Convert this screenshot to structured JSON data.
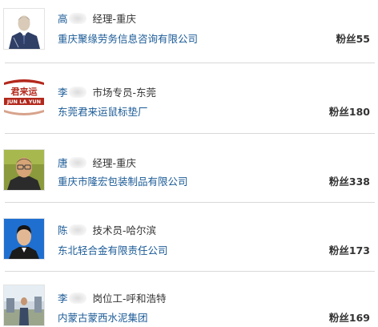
{
  "people": [
    {
      "surname": "高",
      "role": "经理-重庆",
      "company": "重庆聚缘劳务信息咨询有限公司",
      "fans_label": "粉丝55",
      "avatar_icon": "man-in-suit-sketch-icon"
    },
    {
      "surname": "李",
      "role": "市场专员-东莞",
      "company": "东莞君来运鼠标垫厂",
      "fans_label": "粉丝180",
      "avatar_icon": "company-logo-icon",
      "avatar_logo_top": "君来运",
      "avatar_logo_bottom": "JUN LA YUN"
    },
    {
      "surname": "唐",
      "role": "经理-重庆",
      "company": "重庆市隆宏包装制品有限公司",
      "fans_label": "粉丝338",
      "avatar_icon": "man-with-glasses-photo-icon"
    },
    {
      "surname": "陈",
      "role": "技术员-哈尔滨",
      "company": "东北轻合金有限责任公司",
      "fans_label": "粉丝173",
      "avatar_icon": "id-photo-blue-background-icon"
    },
    {
      "surname": "李",
      "role": "岗位工-呼和浩特",
      "company": "内蒙古蒙西水泥集团",
      "fans_label": "粉丝169",
      "avatar_icon": "person-standing-outdoor-photo-icon"
    }
  ],
  "colors": {
    "link": "#1a5a96",
    "text": "#333333",
    "divider": "#d8d8d8"
  }
}
